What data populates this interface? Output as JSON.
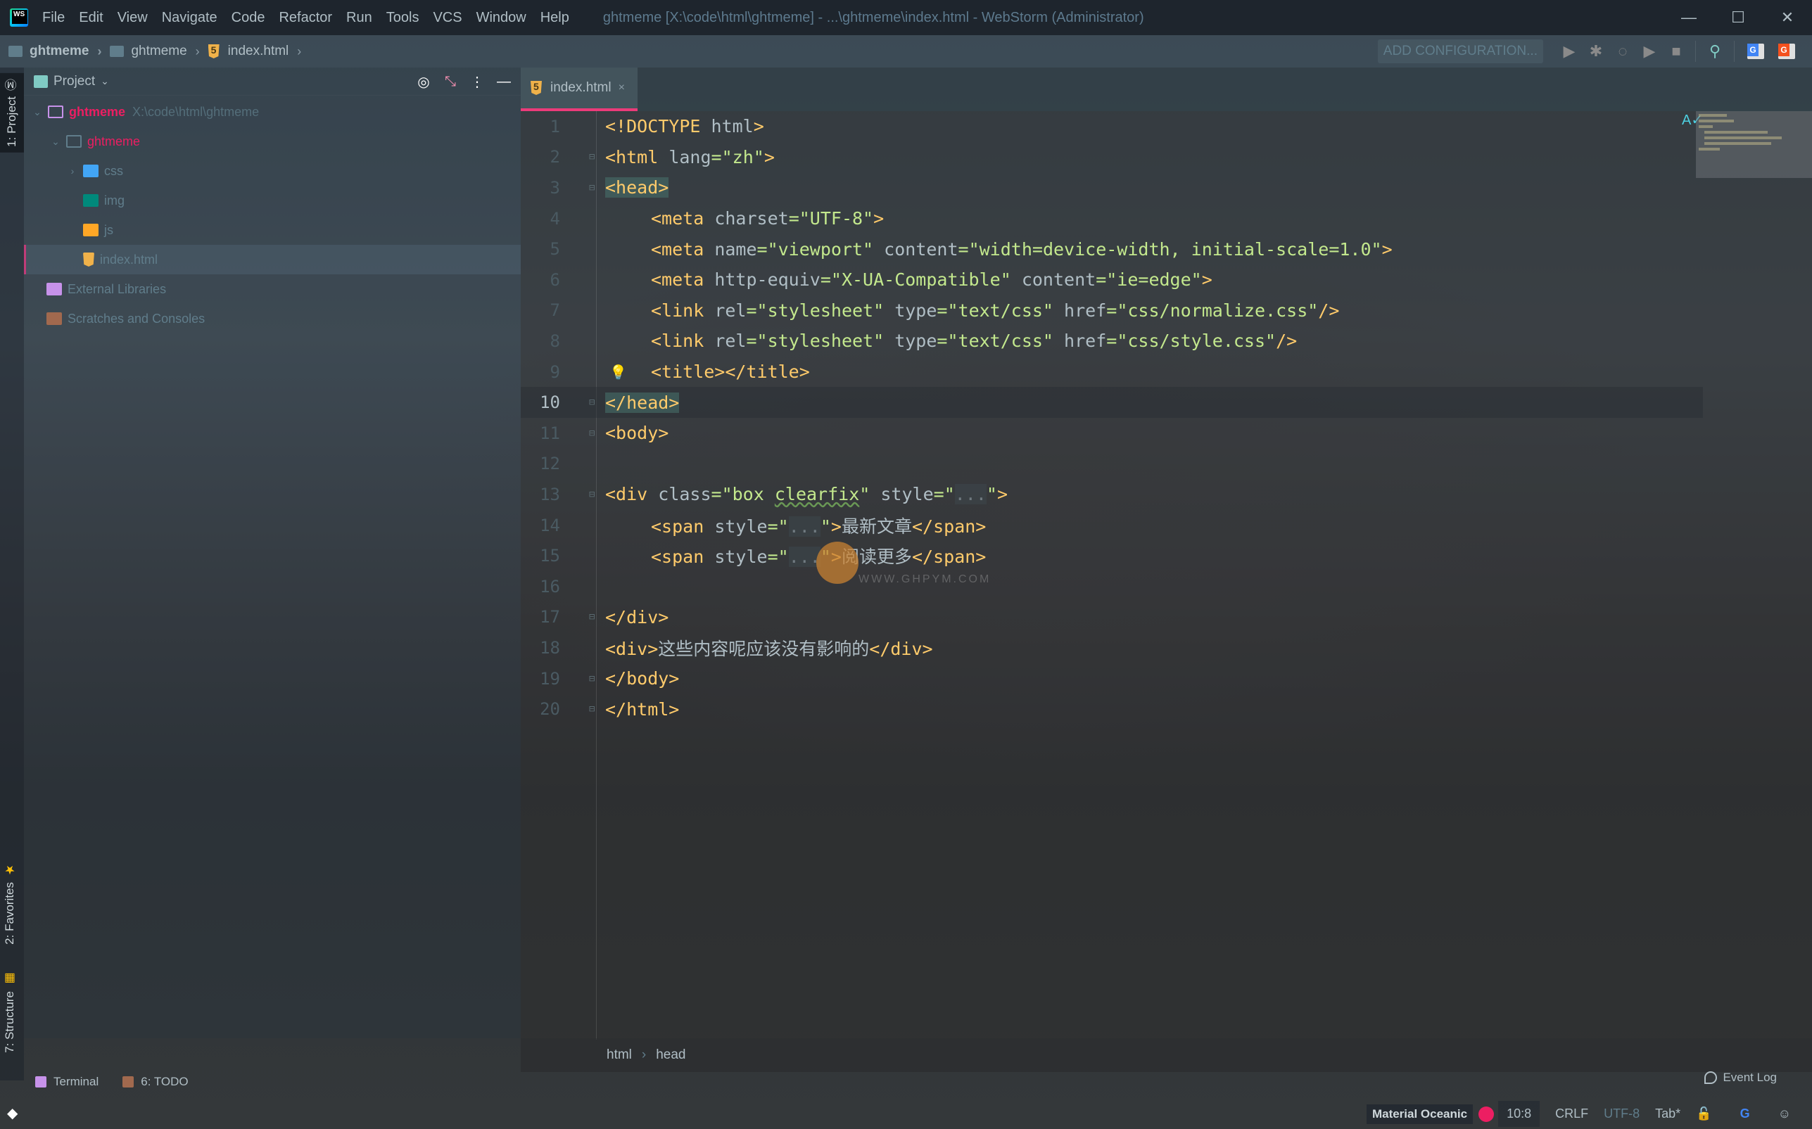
{
  "titlebar": {
    "menu": [
      "File",
      "Edit",
      "View",
      "Navigate",
      "Code",
      "Refactor",
      "Run",
      "Tools",
      "VCS",
      "Window",
      "Help"
    ],
    "window_title": "ghtmeme [X:\\code\\html\\ghtmeme] - ...\\ghtmeme\\index.html - WebStorm (Administrator)",
    "controls": {
      "minimize": "—",
      "maximize": "☐",
      "close": "✕"
    }
  },
  "navbar": {
    "breadcrumbs": [
      "ghtmeme",
      "ghtmeme",
      "index.html"
    ],
    "add_configuration": "ADD CONFIGURATION...",
    "icons": [
      "run-icon",
      "debug-icon",
      "coverage-icon",
      "profile-icon",
      "stop-icon",
      "search-icon",
      "translate-icon",
      "translate-alt-icon"
    ]
  },
  "left_strip": {
    "tabs": [
      "1: Project",
      "2: Favorites",
      "7: Structure"
    ]
  },
  "project_panel": {
    "title": "Project",
    "tree": [
      {
        "name": "ghtmeme",
        "path": "X:\\code\\html\\ghtmeme",
        "type": "root"
      },
      {
        "name": "ghtmeme",
        "type": "folder"
      },
      {
        "name": "css",
        "type": "css-folder"
      },
      {
        "name": "img",
        "type": "img-folder"
      },
      {
        "name": "js",
        "type": "js-folder"
      },
      {
        "name": "index.html",
        "type": "html-file",
        "selected": true
      },
      {
        "name": "External Libraries",
        "type": "libraries"
      },
      {
        "name": "Scratches and Consoles",
        "type": "scratches"
      }
    ]
  },
  "editor": {
    "tab": {
      "label": "index.html",
      "close": "×"
    },
    "current_line": 10,
    "lines": [
      {
        "n": "1"
      },
      {
        "n": "2"
      },
      {
        "n": "3"
      },
      {
        "n": "4"
      },
      {
        "n": "5"
      },
      {
        "n": "6"
      },
      {
        "n": "7"
      },
      {
        "n": "8"
      },
      {
        "n": "9"
      },
      {
        "n": "10"
      },
      {
        "n": "11"
      },
      {
        "n": "12"
      },
      {
        "n": "13"
      },
      {
        "n": "14"
      },
      {
        "n": "15"
      },
      {
        "n": "16"
      },
      {
        "n": "17"
      },
      {
        "n": "18"
      },
      {
        "n": "19"
      },
      {
        "n": "20"
      }
    ],
    "code": {
      "l1_tag": "<!DOCTYPE",
      "l1_rest": " html",
      "l1_end": ">",
      "l2_tag": "<html",
      "l2_attr": " lang",
      "l2_eq": "=",
      "l2_val": "\"zh\"",
      "l2_end": ">",
      "l3": "<head>",
      "l4_tag": "<meta",
      "l4_attr": " charset",
      "l4_eq": "=",
      "l4_val": "\"UTF-8\"",
      "l4_end": ">",
      "l5_tag": "<meta",
      "l5_a1": " name",
      "l5_v1": "=\"viewport\"",
      "l5_a2": " content",
      "l5_v2": "=\"width=device-width, initial-scale=1.0\"",
      "l5_end": ">",
      "l6_tag": "<meta",
      "l6_a1": " http-equiv",
      "l6_v1": "=\"X-UA-Compatible\"",
      "l6_a2": " content",
      "l6_v2": "=\"ie=edge\"",
      "l6_end": ">",
      "l7_tag": "<link",
      "l7_a1": " rel",
      "l7_v1": "=\"stylesheet\"",
      "l7_a2": " type",
      "l7_v2": "=\"text/css\"",
      "l7_a3": " href",
      "l7_v3": "=\"css/normalize.css\"",
      "l7_end": "/>",
      "l8_tag": "<link",
      "l8_a1": " rel",
      "l8_v1": "=\"stylesheet\"",
      "l8_a2": " type",
      "l8_v2": "=\"text/css\"",
      "l8_a3": " href",
      "l8_v3": "=\"css/style.css\"",
      "l8_end": "/>",
      "l9": "<title></title>",
      "l10": "</head>",
      "l11": "<body>",
      "l13_tag": "<div",
      "l13_a1": " class",
      "l13_v1a": "=\"box ",
      "l13_v1b": "clearfix",
      "l13_v1c": "\"",
      "l13_a2": " style",
      "l13_q1": "=\"",
      "l13_fold": "...",
      "l13_q2": "\"",
      "l13_end": ">",
      "l14_tag": "<span",
      "l14_a": " style",
      "l14_q1": "=\"",
      "l14_fold": "...",
      "l14_q2": "\"",
      "l14_gt": ">",
      "l14_text": "最新文章",
      "l14_close": "</span>",
      "l15_tag": "<span",
      "l15_a": " style",
      "l15_q1": "=\"",
      "l15_fold": "...",
      "l15_q2": "\"",
      "l15_gt": ">",
      "l15_text": "阅读更多",
      "l15_close": "</span>",
      "l17": "</div>",
      "l18_open": "<div>",
      "l18_text": "这些内容呢应该没有影响的",
      "l18_close": "</div>",
      "l19": "</body>",
      "l20": "</html>"
    },
    "breadcrumbs": [
      "html",
      "head"
    ]
  },
  "bottom_tools": {
    "terminal": "Terminal",
    "todo": "6: TODO",
    "event_log": "Event Log"
  },
  "statusbar": {
    "theme": "Material Oceanic",
    "theme_color": "#ec1e62",
    "position": "10:8",
    "line_separator": "CRLF",
    "encoding": "UTF-8",
    "indent": "Tab*"
  },
  "watermark": "WWW.GHPYM.COM"
}
